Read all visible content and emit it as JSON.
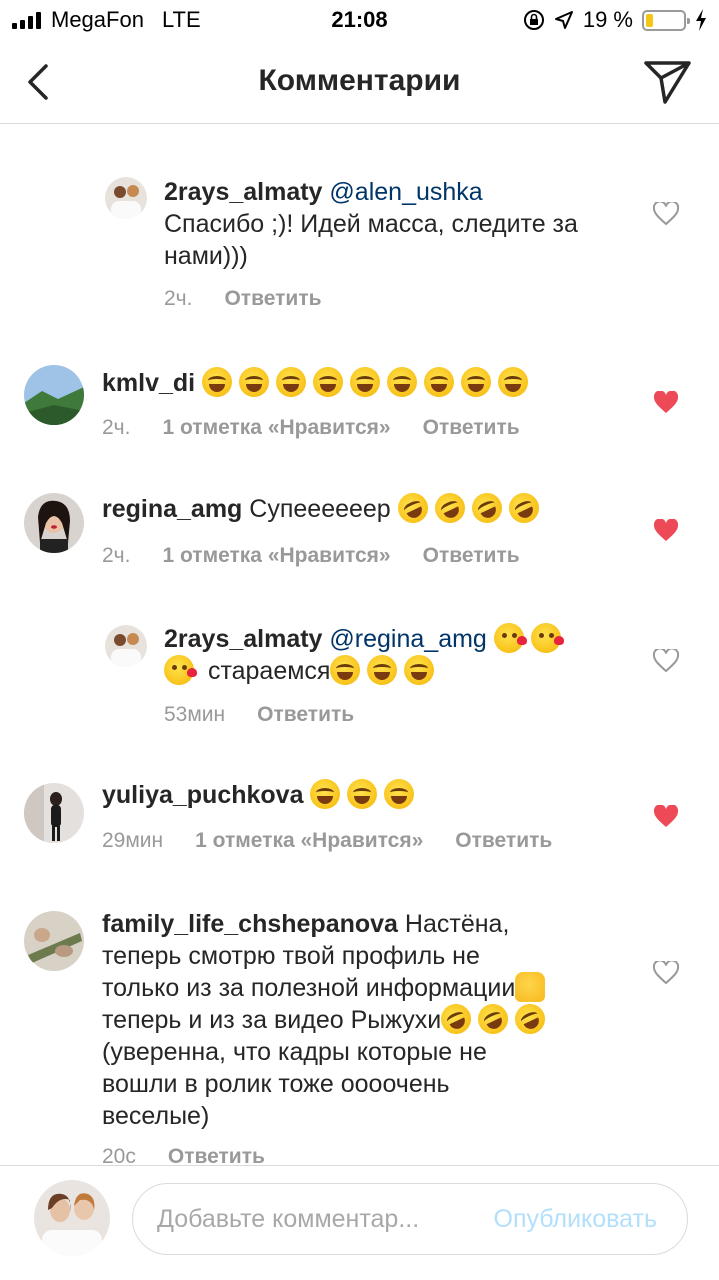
{
  "status_bar": {
    "carrier": "MegaFon",
    "network": "LTE",
    "time": "21:08",
    "battery": "19 %",
    "battery_level": 0.19
  },
  "header": {
    "title": "Комментарии"
  },
  "comments": [
    {
      "username": "2rays_almaty",
      "mention": "@alen_ushka",
      "text": "Спасибо ;)! Идей масса, следите за нами)))",
      "time": "2ч.",
      "reply_label": "Ответить",
      "liked": false
    },
    {
      "username": "kmlv_di",
      "emoji": [
        "face-with-tears-of-joy",
        "face-with-tears-of-joy",
        "face-with-tears-of-joy",
        "face-with-tears-of-joy",
        "face-with-tears-of-joy",
        "face-with-tears-of-joy",
        "face-with-tears-of-joy",
        "face-with-tears-of-joy",
        "face-with-tears-of-joy"
      ],
      "time": "2ч.",
      "likes": "1 отметка «Нравится»",
      "reply_label": "Ответить",
      "liked": true
    },
    {
      "username": "regina_amg",
      "text": "Супеееееер",
      "emoji": [
        "rolling-on-floor-laughing",
        "rolling-on-floor-laughing",
        "rolling-on-floor-laughing",
        "rolling-on-floor-laughing"
      ],
      "time": "2ч.",
      "likes": "1 отметка «Нравится»",
      "reply_label": "Ответить",
      "liked": true
    },
    {
      "username": "2rays_almaty",
      "mention": "@regina_amg",
      "text": "стараемся",
      "time": "53мин",
      "reply_label": "Ответить",
      "liked": false
    },
    {
      "username": "yuliya_puchkova",
      "emoji": [
        "face-with-tears-of-joy",
        "face-with-tears-of-joy",
        "face-with-tears-of-joy"
      ],
      "time": "29мин",
      "likes": "1 отметка «Нравится»",
      "reply_label": "Ответить",
      "liked": true
    },
    {
      "username": "family_life_chshepanova",
      "text_1": "Настёна,",
      "text_2": "теперь смотрю твой профиль не",
      "text_3": "только из за полезной информации",
      "text_4": "теперь и из за видео  Рыжухи",
      "text_5": "(уверенна, что кадры которые не",
      "text_6": "вошли в ролик тоже оооочень",
      "text_7": "веселые)",
      "time": "20с",
      "reply_label": "Ответить",
      "liked": false
    }
  ],
  "input": {
    "placeholder": "Добавьте комментар...",
    "publish_label": "Опубликовать"
  },
  "colors": {
    "like_red": "#ed4956",
    "mention_blue": "#003569",
    "publish_disabled": "#b2dffc",
    "meta_gray": "#999999"
  }
}
